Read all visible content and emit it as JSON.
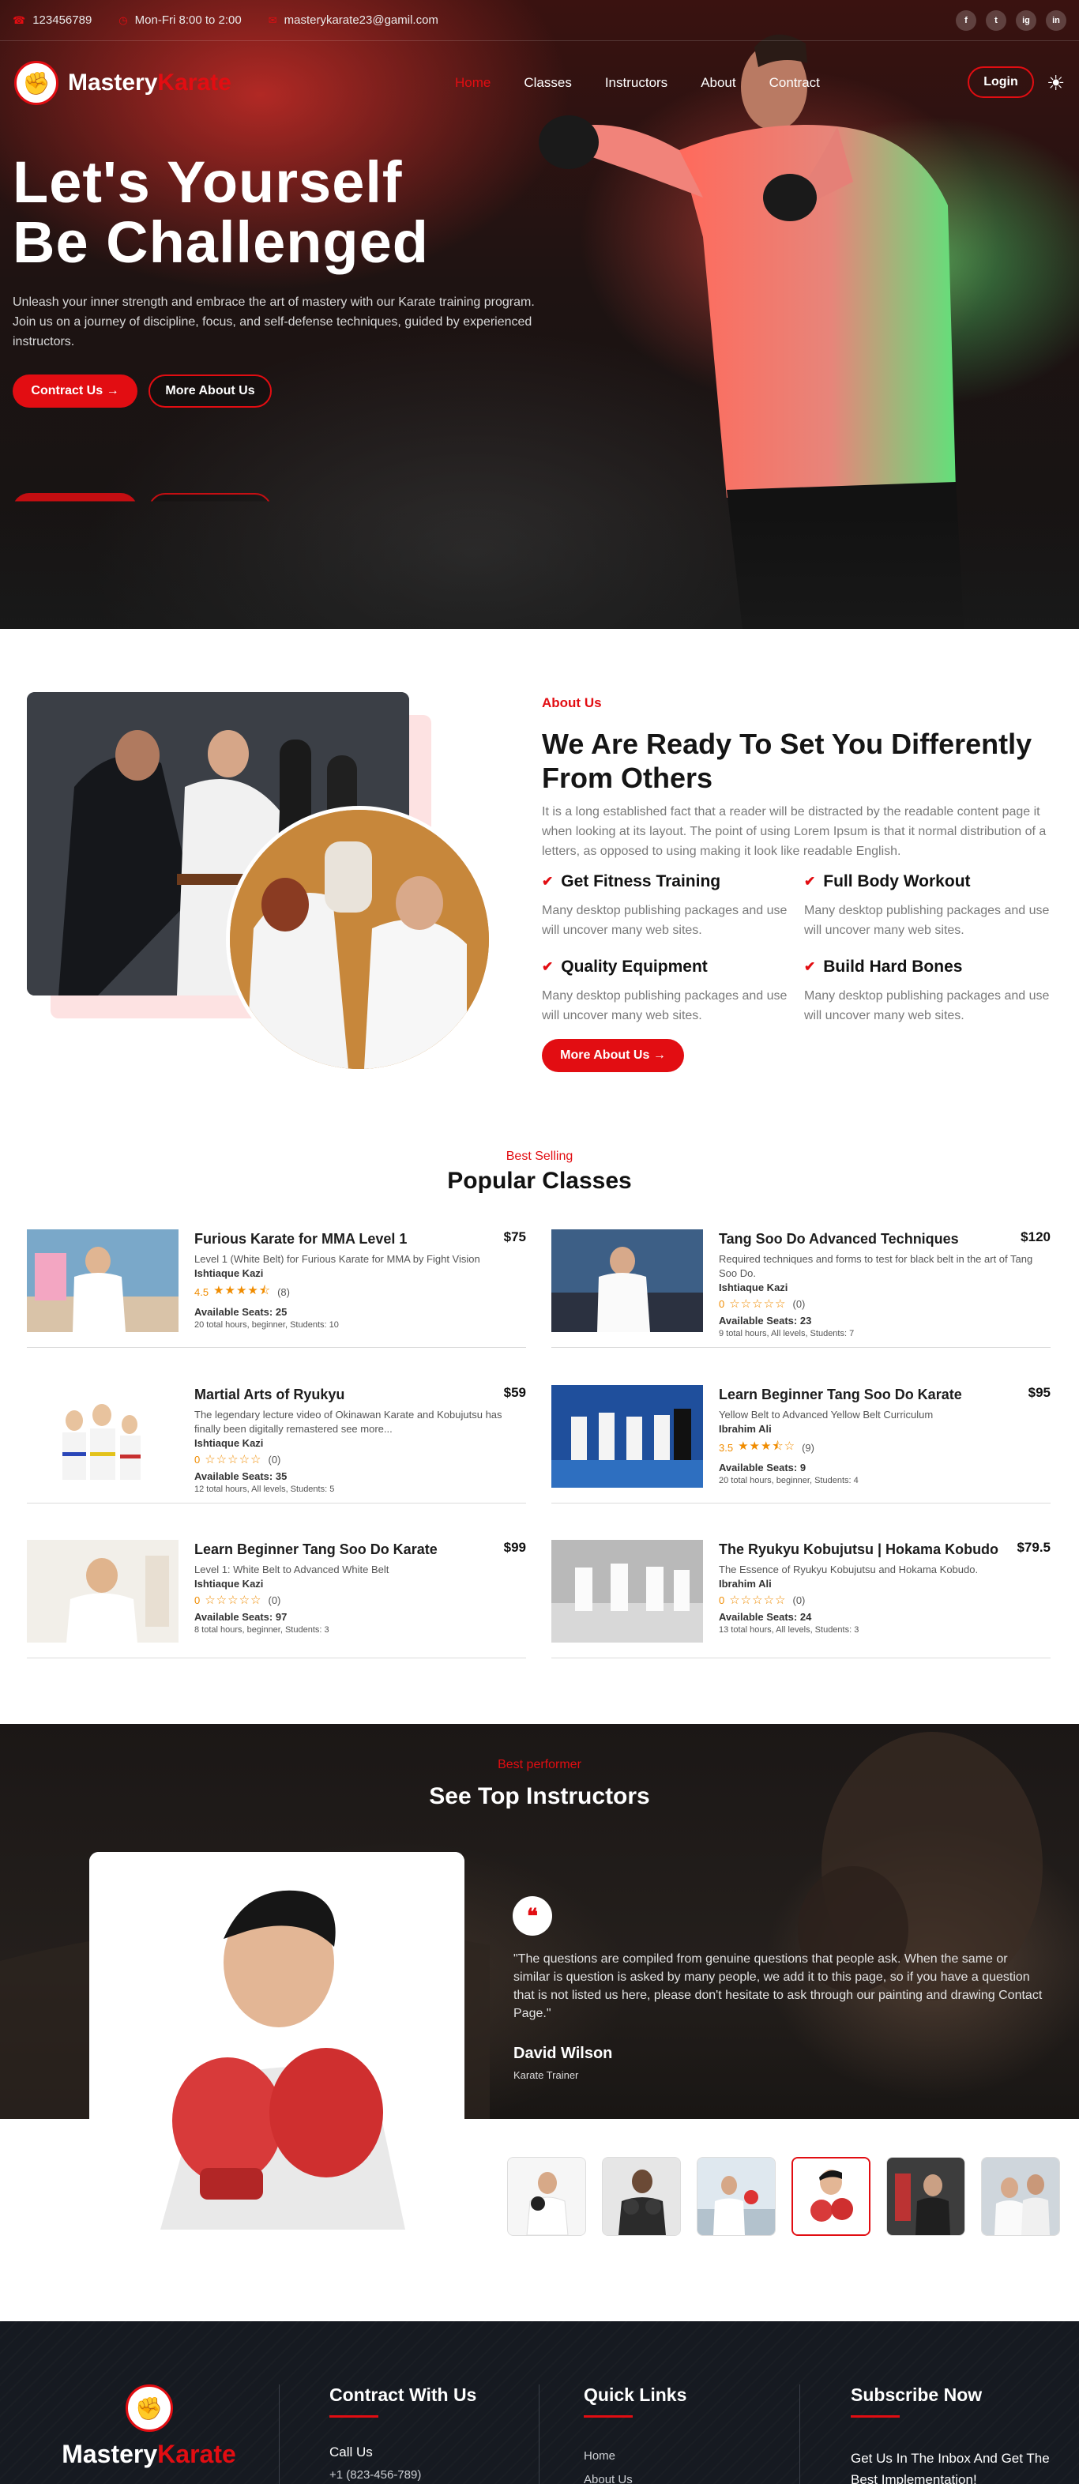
{
  "topbar": {
    "phone": "123456789",
    "hours": "Mon-Fri 8:00 to 2:00",
    "email": "masterykarate23@gamil.com",
    "socials": [
      "f",
      "t",
      "ig",
      "in"
    ]
  },
  "brand": {
    "name_part1": "Mastery",
    "name_part2": "Karate"
  },
  "nav": {
    "items": [
      "Home",
      "Classes",
      "Instructors",
      "About",
      "Contract"
    ],
    "login_label": "Login"
  },
  "hero": {
    "title_line1": "Let's Yourself",
    "title_line2": "Be Challenged",
    "text": "Unleash your inner strength and embrace the art of mastery with our Karate training program. Join us on a journey of discipline, focus, and self-defense techniques, guided by experienced instructors.",
    "primary_button": "Contract Us",
    "secondary_button": "More About Us"
  },
  "about": {
    "label": "About Us",
    "title": "We Are Ready To Set You Differently From Others",
    "text": "It is a long established fact that a reader will be distracted by the readable content page it when looking at its layout. The point of using Lorem Ipsum is that it normal distribution of a letters, as opposed to using making it look like readable English.",
    "features": [
      {
        "title": "Get Fitness Training",
        "text": "Many desktop publishing packages and use will uncover many web sites."
      },
      {
        "title": "Full Body Workout",
        "text": "Many desktop publishing packages and use will uncover many web sites."
      },
      {
        "title": "Quality Equipment",
        "text": "Many desktop publishing packages and use will uncover many web sites."
      },
      {
        "title": "Build Hard Bones",
        "text": "Many desktop publishing packages and use will uncover many web sites."
      }
    ],
    "button": "More About Us"
  },
  "classes": {
    "label": "Best Selling",
    "title": "Popular Classes",
    "items": [
      {
        "title": "Furious Karate for MMA Level 1",
        "desc": "Level 1 (White Belt) for Furious Karate for MMA by Fight Vision",
        "instructor": "Ishtiaque Kazi",
        "rating": "4.5",
        "stars": "★★★★⯪",
        "reviews": "(8)",
        "seats": "Available Seats: 25",
        "meta": "20 total hours, beginner, Students: 10",
        "price": "$75"
      },
      {
        "title": "Tang Soo Do Advanced Techniques",
        "desc": "Required techniques and forms to test for black belt in the art of Tang Soo Do.",
        "instructor": "Ishtiaque Kazi",
        "rating": "0",
        "stars": "☆☆☆☆☆",
        "reviews": "(0)",
        "seats": "Available Seats: 23",
        "meta": "9 total hours, All levels, Students: 7",
        "price": "$120"
      },
      {
        "title": "Martial Arts of Ryukyu",
        "desc": "The legendary lecture video of Okinawan Karate and Kobujutsu has finally been digitally remastered see more...",
        "instructor": "Ishtiaque Kazi",
        "rating": "0",
        "stars": "☆☆☆☆☆",
        "reviews": "(0)",
        "seats": "Available Seats: 35",
        "meta": "12 total hours, All levels, Students: 5",
        "price": "$59"
      },
      {
        "title": "Learn Beginner Tang Soo Do Karate",
        "desc": "Yellow Belt to Advanced Yellow Belt Curriculum",
        "instructor": "Ibrahim Ali",
        "rating": "3.5",
        "stars": "★★★⯪☆",
        "reviews": "(9)",
        "seats": "Available Seats: 9",
        "meta": "20 total hours, beginner, Students: 4",
        "price": "$95"
      },
      {
        "title": "Learn Beginner Tang Soo Do Karate",
        "desc": "Level 1: White Belt to Advanced White Belt",
        "instructor": "Ishtiaque Kazi",
        "rating": "0",
        "stars": "☆☆☆☆☆",
        "reviews": "(0)",
        "seats": "Available Seats: 97",
        "meta": "8 total hours, beginner, Students: 3",
        "price": "$99"
      },
      {
        "title": "The Ryukyu Kobujutsu | Hokama Kobudo",
        "desc": "The Essence of Ryukyu Kobujutsu and Hokama Kobudo.",
        "instructor": "Ibrahim Ali",
        "rating": "0",
        "stars": "☆☆☆☆☆",
        "reviews": "(0)",
        "seats": "Available Seats: 24",
        "meta": "13 total hours, All levels, Students: 3",
        "price": "$79.5"
      }
    ]
  },
  "instructors": {
    "label": "Best performer",
    "title": "See Top Instructors",
    "quote": "\"The questions are compiled from genuine questions that people ask. When the same or similar is question is asked by many people, we add it to this page, so if you have a question that is not listed us here, please don't hesitate to ask through our painting and drawing Contact Page.\"",
    "name": "David Wilson",
    "role": "Karate Trainer"
  },
  "footer": {
    "contact_heading": "Contract With Us",
    "call_label": "Call Us",
    "phone": "+1 (823-456-789)",
    "links_heading": "Quick Links",
    "links": [
      "Home",
      "About Us"
    ],
    "subscribe_heading": "Subscribe Now",
    "subscribe_text": "Get Us In The Inbox And Get The Best Implementation!"
  },
  "colors": {
    "accent": "#e20d12",
    "footer_bg": "#161a21"
  }
}
